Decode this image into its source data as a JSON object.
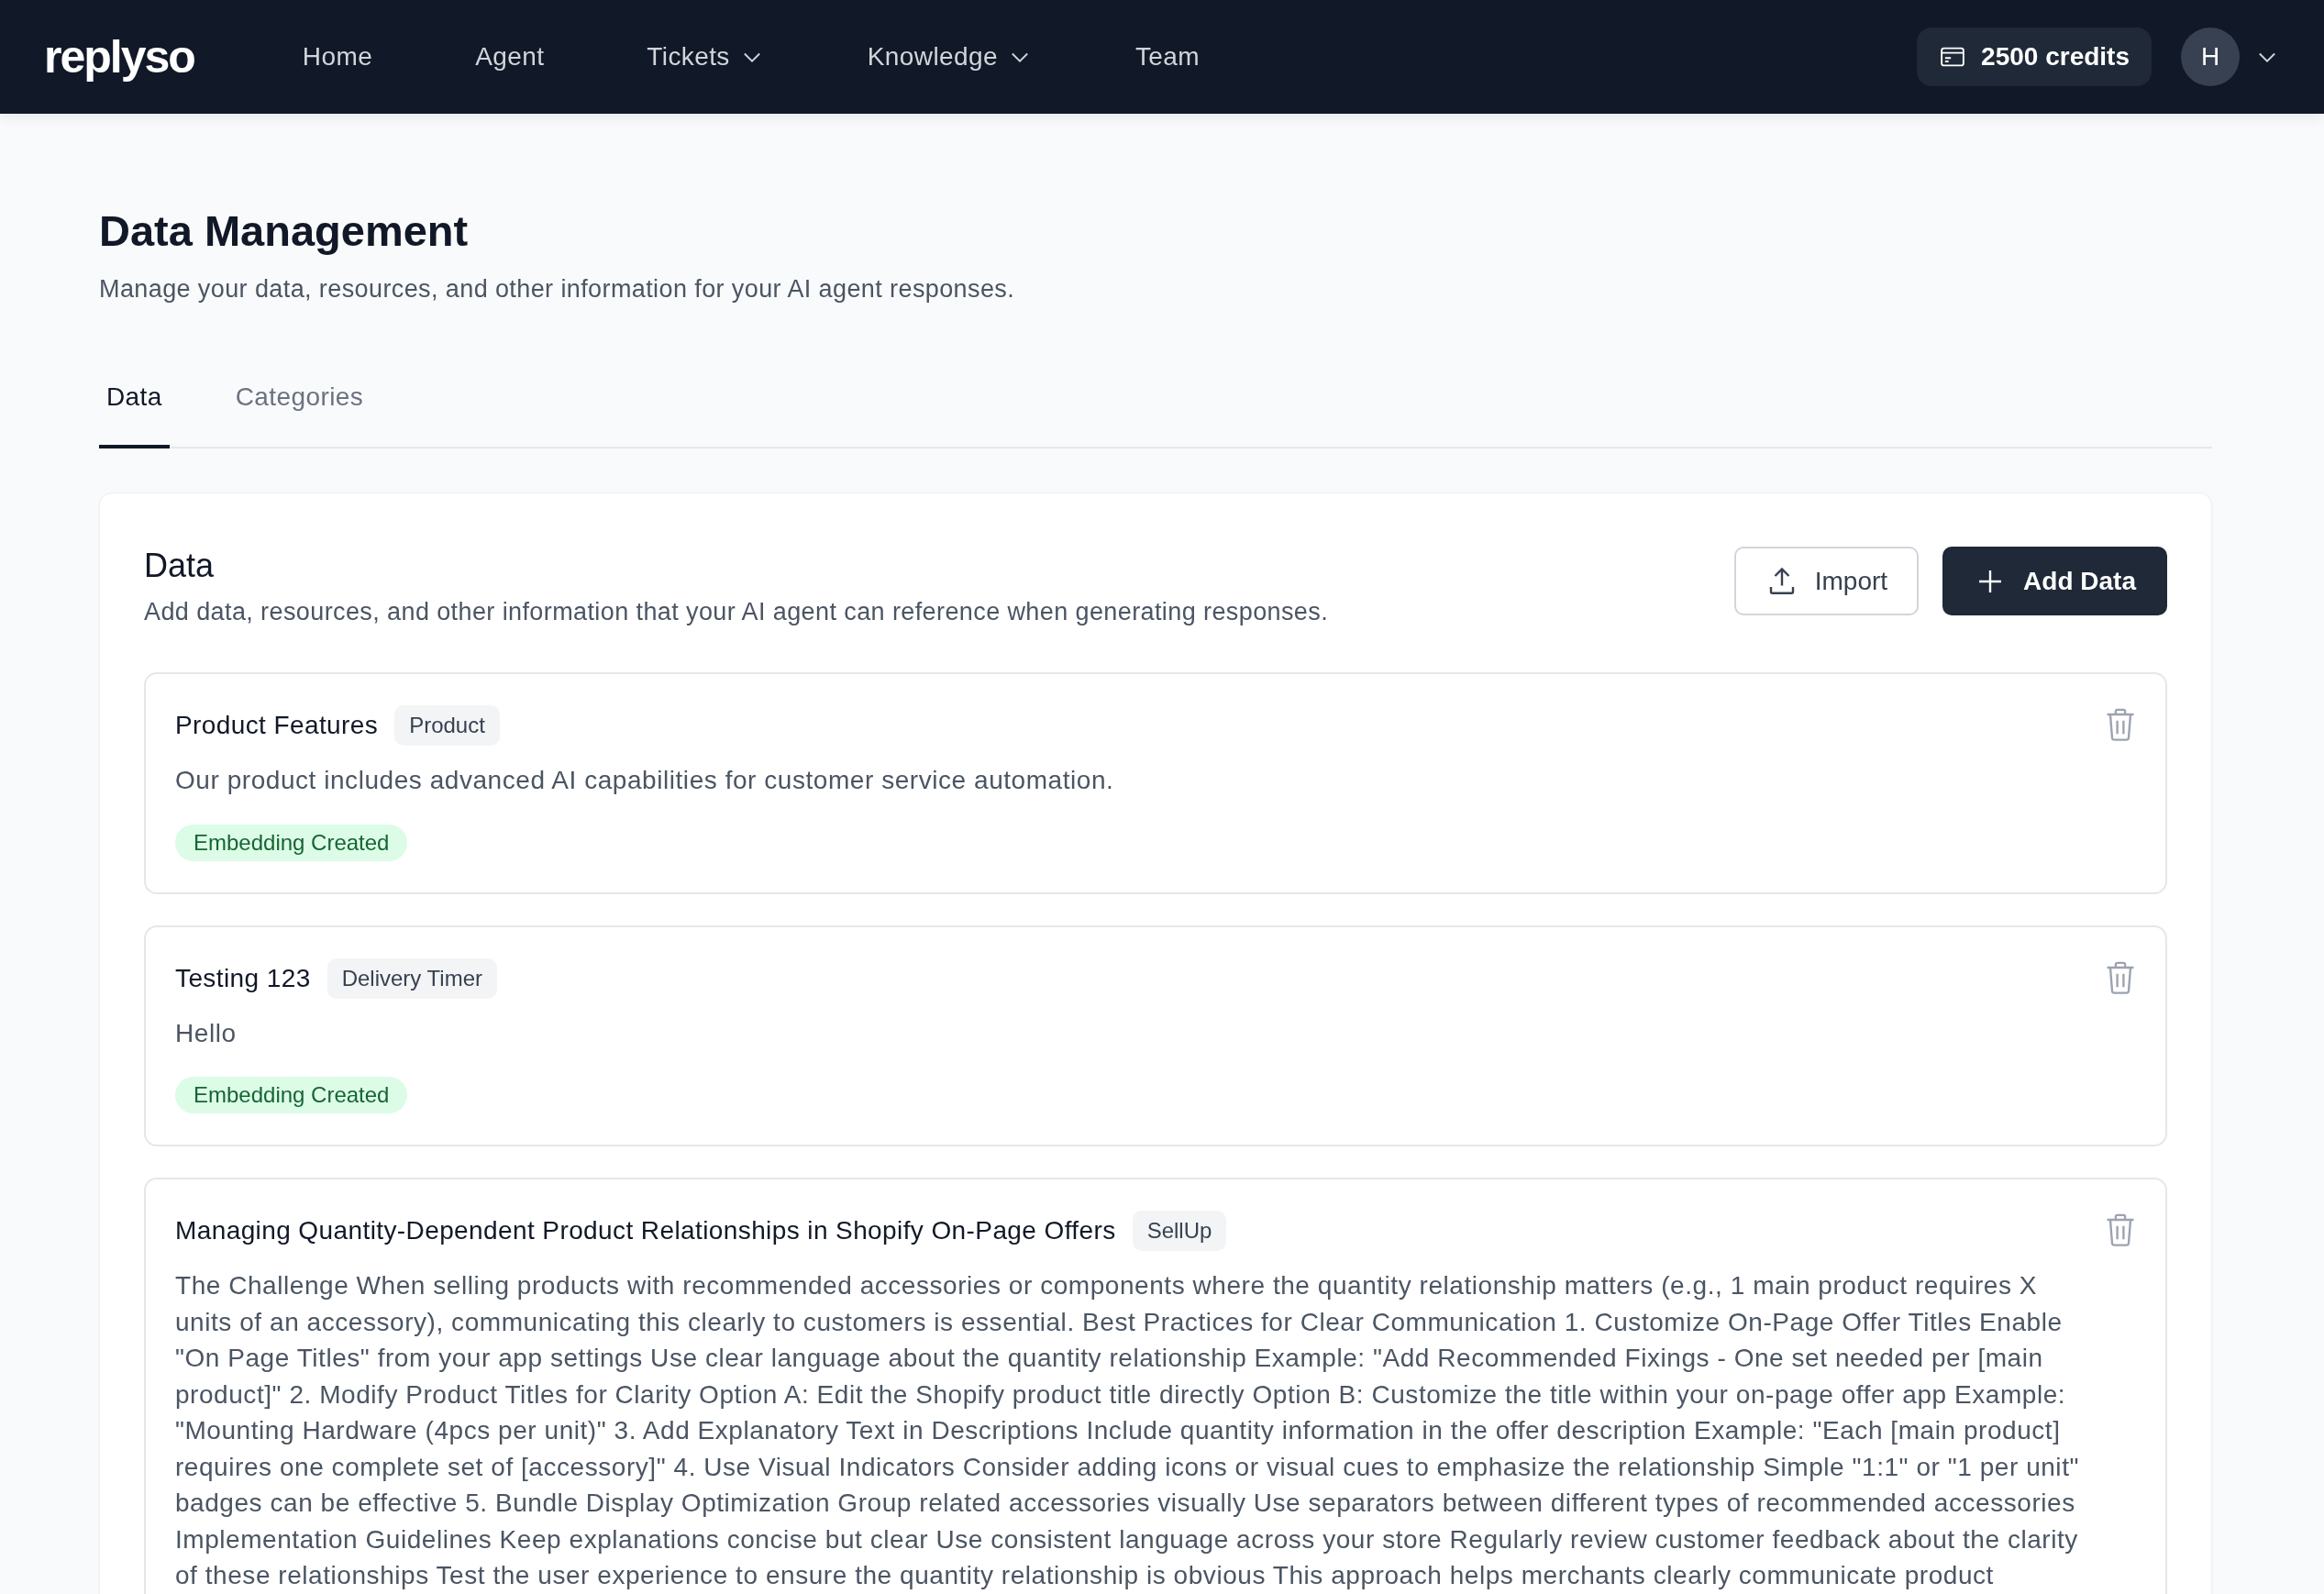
{
  "nav": {
    "logo": "replyso",
    "items": [
      {
        "label": "Home",
        "dropdown": false
      },
      {
        "label": "Agent",
        "dropdown": false
      },
      {
        "label": "Tickets",
        "dropdown": true
      },
      {
        "label": "Knowledge",
        "dropdown": true
      },
      {
        "label": "Team",
        "dropdown": false
      }
    ],
    "credits": "2500 credits",
    "avatar": "H"
  },
  "page": {
    "title": "Data Management",
    "subtitle": "Manage your data, resources, and other information for your AI agent responses."
  },
  "tabs": [
    {
      "label": "Data",
      "selected": true
    },
    {
      "label": "Categories",
      "selected": false
    }
  ],
  "panel": {
    "title": "Data",
    "description": "Add data, resources, and other information that your AI agent can reference when generating responses.",
    "buttons": [
      {
        "label": "Import",
        "kind": "secondary"
      },
      {
        "label": "Add Data",
        "kind": "primary"
      }
    ],
    "items": [
      {
        "title": "Product Features",
        "tag": "Product",
        "body": "Our product includes advanced AI capabilities for customer service automation.",
        "status": "Embedding Created"
      },
      {
        "title": "Testing 123",
        "tag": "Delivery Timer",
        "body": "Hello",
        "status": "Embedding Created"
      },
      {
        "title": "Managing Quantity-Dependent Product Relationships in Shopify On-Page Offers",
        "tag": "SellUp",
        "body": "The Challenge When selling products with recommended accessories or components where the quantity relationship matters (e.g., 1 main product requires X units of an accessory), communicating this clearly to customers is essential. Best Practices for Clear Communication 1. Customize On-Page Offer Titles Enable \"On Page Titles\" from your app settings Use clear language about the quantity relationship Example: \"Add Recommended Fixings - One set needed per [main product]\" 2. Modify Product Titles for Clarity Option A: Edit the Shopify product title directly Option B: Customize the title within your on-page offer app Example: \"Mounting Hardware (4pcs per unit)\" 3. Add Explanatory Text in Descriptions Include quantity information in the offer description Example: \"Each [main product] requires one complete set of [accessory]\" 4. Use Visual Indicators Consider adding icons or visual cues to emphasize the relationship Simple \"1:1\" or \"1 per unit\" badges can be effective 5. Bundle Display Optimization Group related accessories visually Use separators between different types of recommended accessories Implementation Guidelines Keep explanations concise but clear Use consistent language across your store Regularly review customer feedback about the clarity of these relationships Test the user experience to ensure the quantity relationship is obvious This approach helps merchants clearly communicate product"
      }
    ]
  }
}
